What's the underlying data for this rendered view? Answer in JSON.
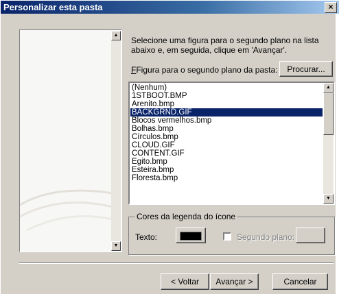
{
  "window": {
    "title": "Personalizar esta pasta",
    "close_glyph": "×"
  },
  "instructions": "Selecione uma figura para o segundo plano na lista abaixo e, em seguida, clique em 'Avançar'.",
  "folder_image_label": "Figura para o segundo plano da pasta:",
  "browse_button": {
    "label": "Procurar..."
  },
  "image_list": {
    "items": [
      "(Nenhum)",
      "1STBOOT.BMP",
      "Arenito.bmp",
      "BACKGRND.GIF",
      "Blocos vermelhos.bmp",
      "Bolhas.bmp",
      "Círculos.bmp",
      "CLOUD.GIF",
      "CONTENT.GIF",
      "Egito.bmp",
      "Esteira.bmp",
      "Floresta.bmp"
    ],
    "selected": "BACKGRND.GIF"
  },
  "icon_caption_colors": {
    "legend": "Cores da legenda do ícone",
    "text_label": "Texto:",
    "text_color": "#000000",
    "background_checkbox_label": "Segundo plano:",
    "background_checked": false
  },
  "buttons": {
    "back": "< Voltar",
    "next": "Avançar >",
    "cancel": "Cancelar"
  },
  "colors": {
    "title_bar": "#0a246a",
    "selection": "#0a246a",
    "window_face": "#d4d0c8"
  }
}
